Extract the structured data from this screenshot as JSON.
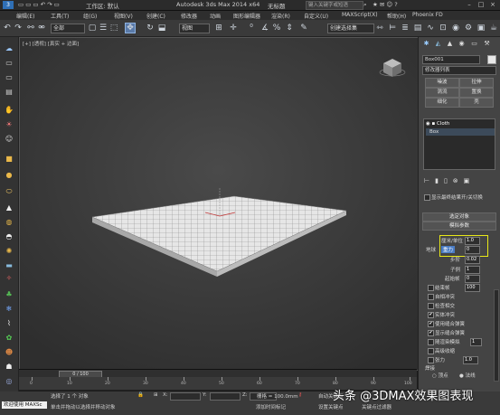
{
  "title_bar": {
    "logo": "3",
    "workspace": "工作区: 默认",
    "app_title": "Autodesk 3ds Max 2014 x64",
    "file_name": "无标题",
    "search_placeholder": "键入关键字或短语"
  },
  "menu": [
    "编辑(E)",
    "工具(T)",
    "组(G)",
    "视图(V)",
    "创建(C)",
    "修改器",
    "动画",
    "图形编辑器",
    "渲染(R)",
    "自定义(U)",
    "MAXScript(X)",
    "帮助(H)",
    "Phoenix FD"
  ],
  "toolbar": {
    "selection_filter": "全部",
    "ref_coord": "视图",
    "named_selection": "创建选择集"
  },
  "viewport": {
    "label": "[+] [透视] [真实 + 边面]"
  },
  "command_panel": {
    "object_name": "Box001",
    "modifier_list": "修改器列表",
    "object_buttons": [
      "噪波",
      "拉伸",
      "涡流",
      "置换",
      "细化",
      "壳"
    ],
    "stack": [
      "Cloth",
      "Box"
    ],
    "show_end_result": "显示最终结果开/关切换",
    "rollouts": {
      "objects": "选定对象",
      "params": "模拟参数"
    },
    "params": {
      "cm_per_unit_label": "厘米/单位",
      "cm_per_unit_value": "1.0",
      "earth_label": "地球",
      "gravity_label": "重力",
      "gravity_value": "0",
      "step_label": "步阶",
      "step_value": "0.02",
      "subsample_label": "子例",
      "subsample_value": "1",
      "start_frame_label": "起始帧",
      "start_frame_value": "0",
      "end_frame_label": "结束帧",
      "end_frame_value": "100",
      "checks": [
        {
          "label": "自相冲突",
          "checked": false
        },
        {
          "label": "检查相交",
          "checked": false
        },
        {
          "label": "实体冲突",
          "checked": true
        },
        {
          "label": "使用缝合弹簧",
          "checked": true
        },
        {
          "label": "显示缝合弹簧",
          "checked": true
        },
        {
          "label": "随渲染模拟",
          "checked": false
        },
        {
          "label": "高级收缩",
          "checked": false
        }
      ],
      "render_sim_value": "1",
      "tension_label": "张力",
      "tension_value": "1.0",
      "weld_label": "焊接",
      "radio_vertex": "顶点",
      "radio_normal": "法线"
    }
  },
  "timeline": {
    "frame_display": "0 / 100",
    "ticks": [
      "0",
      "10",
      "20",
      "30",
      "40",
      "50",
      "60",
      "70",
      "80",
      "90",
      "100"
    ]
  },
  "status": {
    "welcome": "欢迎使用 MAXSc",
    "selected": "选择了 1 个 对象",
    "hint": "单击并拖动以选择并移动对象",
    "grid": "栅格 = 100.0mm",
    "auto_key": "自动关键点",
    "set_key": "设置关键点",
    "add_time_tag": "添加时间标记",
    "key_filter": "关键点过滤器"
  },
  "watermark": "头条 @3DMAX效果图表现",
  "colors": {
    "highlight": "#e8e818",
    "selected_tool": "#5a7aa8",
    "viewport_bg": "#3d3d3d"
  }
}
